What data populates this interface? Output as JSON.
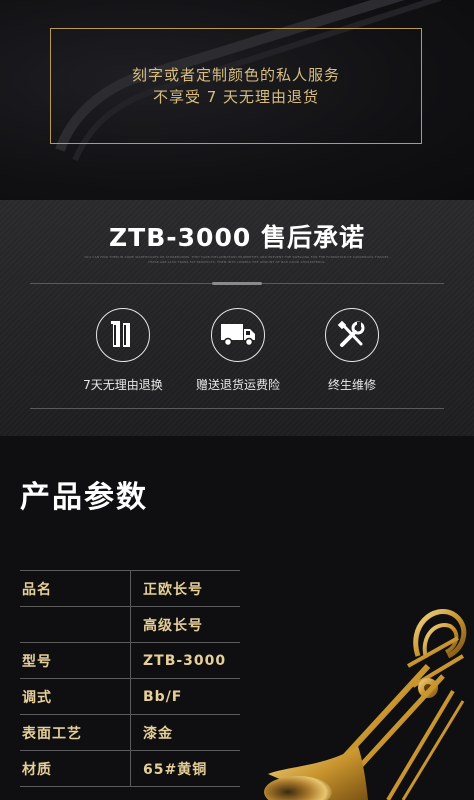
{
  "notice": {
    "line1": "刻字或者定制颜色的私人服务",
    "line2": "不享受 7 天无理由退货"
  },
  "promise": {
    "title": "ZTB-3000 售后承诺",
    "subtitle": "YOU CAN FIND THEM IN SOME WAREHOUSES OR STOREROOMS. THEY HAVE INFLAMMATORY PROPERTIES AND PREVENT THE SWELLING FOR THE FORMATION OF CANCEROUS TISSUES. THESE ARE ALSO TRANS FAT PRODUCTS. THEM INTO LOWERS THE AMOUNT OF BAD GOOD CHOLESTEROL.",
    "features": [
      {
        "icon": "return-7-days-icon",
        "label": "7天无理由退换"
      },
      {
        "icon": "delivery-truck-icon",
        "label": "赠送退货运费险"
      },
      {
        "icon": "tools-wrench-screwdriver-icon",
        "label": "终生维修"
      }
    ]
  },
  "params": {
    "title": "产品参数",
    "rows": [
      {
        "key": "品名",
        "value": "正欧长号"
      },
      {
        "key": "",
        "value": "高级长号"
      },
      {
        "key": "型号",
        "value": "ZTB-3000"
      },
      {
        "key": "调式",
        "value": "Bb/F"
      },
      {
        "key": "表面工艺",
        "value": "漆金"
      },
      {
        "key": "材质",
        "value": "65#黄铜"
      }
    ]
  },
  "colors": {
    "gold": "#d9bd7e",
    "background": "#0f0f11",
    "promise_bg": "#262628"
  }
}
